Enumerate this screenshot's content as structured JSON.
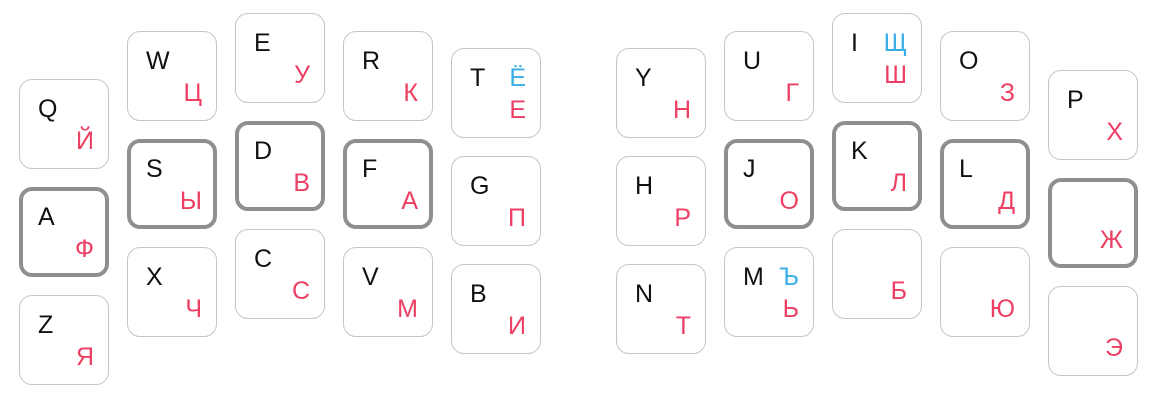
{
  "keys": [
    {
      "id": "q",
      "latin": "Q",
      "cyrillic": "Й",
      "alt": ""
    },
    {
      "id": "a",
      "latin": "A",
      "cyrillic": "Ф",
      "alt": ""
    },
    {
      "id": "z",
      "latin": "Z",
      "cyrillic": "Я",
      "alt": ""
    },
    {
      "id": "w",
      "latin": "W",
      "cyrillic": "Ц",
      "alt": ""
    },
    {
      "id": "s",
      "latin": "S",
      "cyrillic": "Ы",
      "alt": ""
    },
    {
      "id": "x",
      "latin": "X",
      "cyrillic": "Ч",
      "alt": ""
    },
    {
      "id": "e",
      "latin": "E",
      "cyrillic": "У",
      "alt": ""
    },
    {
      "id": "d",
      "latin": "D",
      "cyrillic": "В",
      "alt": ""
    },
    {
      "id": "c",
      "latin": "C",
      "cyrillic": "С",
      "alt": ""
    },
    {
      "id": "r",
      "latin": "R",
      "cyrillic": "К",
      "alt": ""
    },
    {
      "id": "f",
      "latin": "F",
      "cyrillic": "А",
      "alt": ""
    },
    {
      "id": "v",
      "latin": "V",
      "cyrillic": "М",
      "alt": ""
    },
    {
      "id": "t",
      "latin": "T",
      "cyrillic": "Е",
      "alt": "Ё"
    },
    {
      "id": "g",
      "latin": "G",
      "cyrillic": "П",
      "alt": ""
    },
    {
      "id": "b",
      "latin": "B",
      "cyrillic": "И",
      "alt": ""
    },
    {
      "id": "y",
      "latin": "Y",
      "cyrillic": "Н",
      "alt": ""
    },
    {
      "id": "h",
      "latin": "H",
      "cyrillic": "Р",
      "alt": ""
    },
    {
      "id": "n",
      "latin": "N",
      "cyrillic": "Т",
      "alt": ""
    },
    {
      "id": "u",
      "latin": "U",
      "cyrillic": "Г",
      "alt": ""
    },
    {
      "id": "j",
      "latin": "J",
      "cyrillic": "О",
      "alt": ""
    },
    {
      "id": "m",
      "latin": "M",
      "cyrillic": "Ь",
      "alt": "Ъ"
    },
    {
      "id": "i",
      "latin": "I",
      "cyrillic": "Ш",
      "alt": "Щ"
    },
    {
      "id": "k",
      "latin": "K",
      "cyrillic": "Л",
      "alt": ""
    },
    {
      "id": "comma",
      "latin": "",
      "cyrillic": "Б",
      "alt": ""
    },
    {
      "id": "o",
      "latin": "O",
      "cyrillic": "З",
      "alt": ""
    },
    {
      "id": "l",
      "latin": "L",
      "cyrillic": "Д",
      "alt": ""
    },
    {
      "id": "period",
      "latin": "",
      "cyrillic": "Ю",
      "alt": ""
    },
    {
      "id": "p",
      "latin": "P",
      "cyrillic": "Х",
      "alt": ""
    },
    {
      "id": "semicolon",
      "latin": "",
      "cyrillic": "Ж",
      "alt": ""
    },
    {
      "id": "slash",
      "latin": "",
      "cyrillic": "Э",
      "alt": ""
    }
  ],
  "colors": {
    "latin": "#111111",
    "cyrillic": "#ec3f63",
    "alternate": "#3aaee6",
    "key_border": "#c6c6c6",
    "home_key_border": "#8f8f8f"
  }
}
